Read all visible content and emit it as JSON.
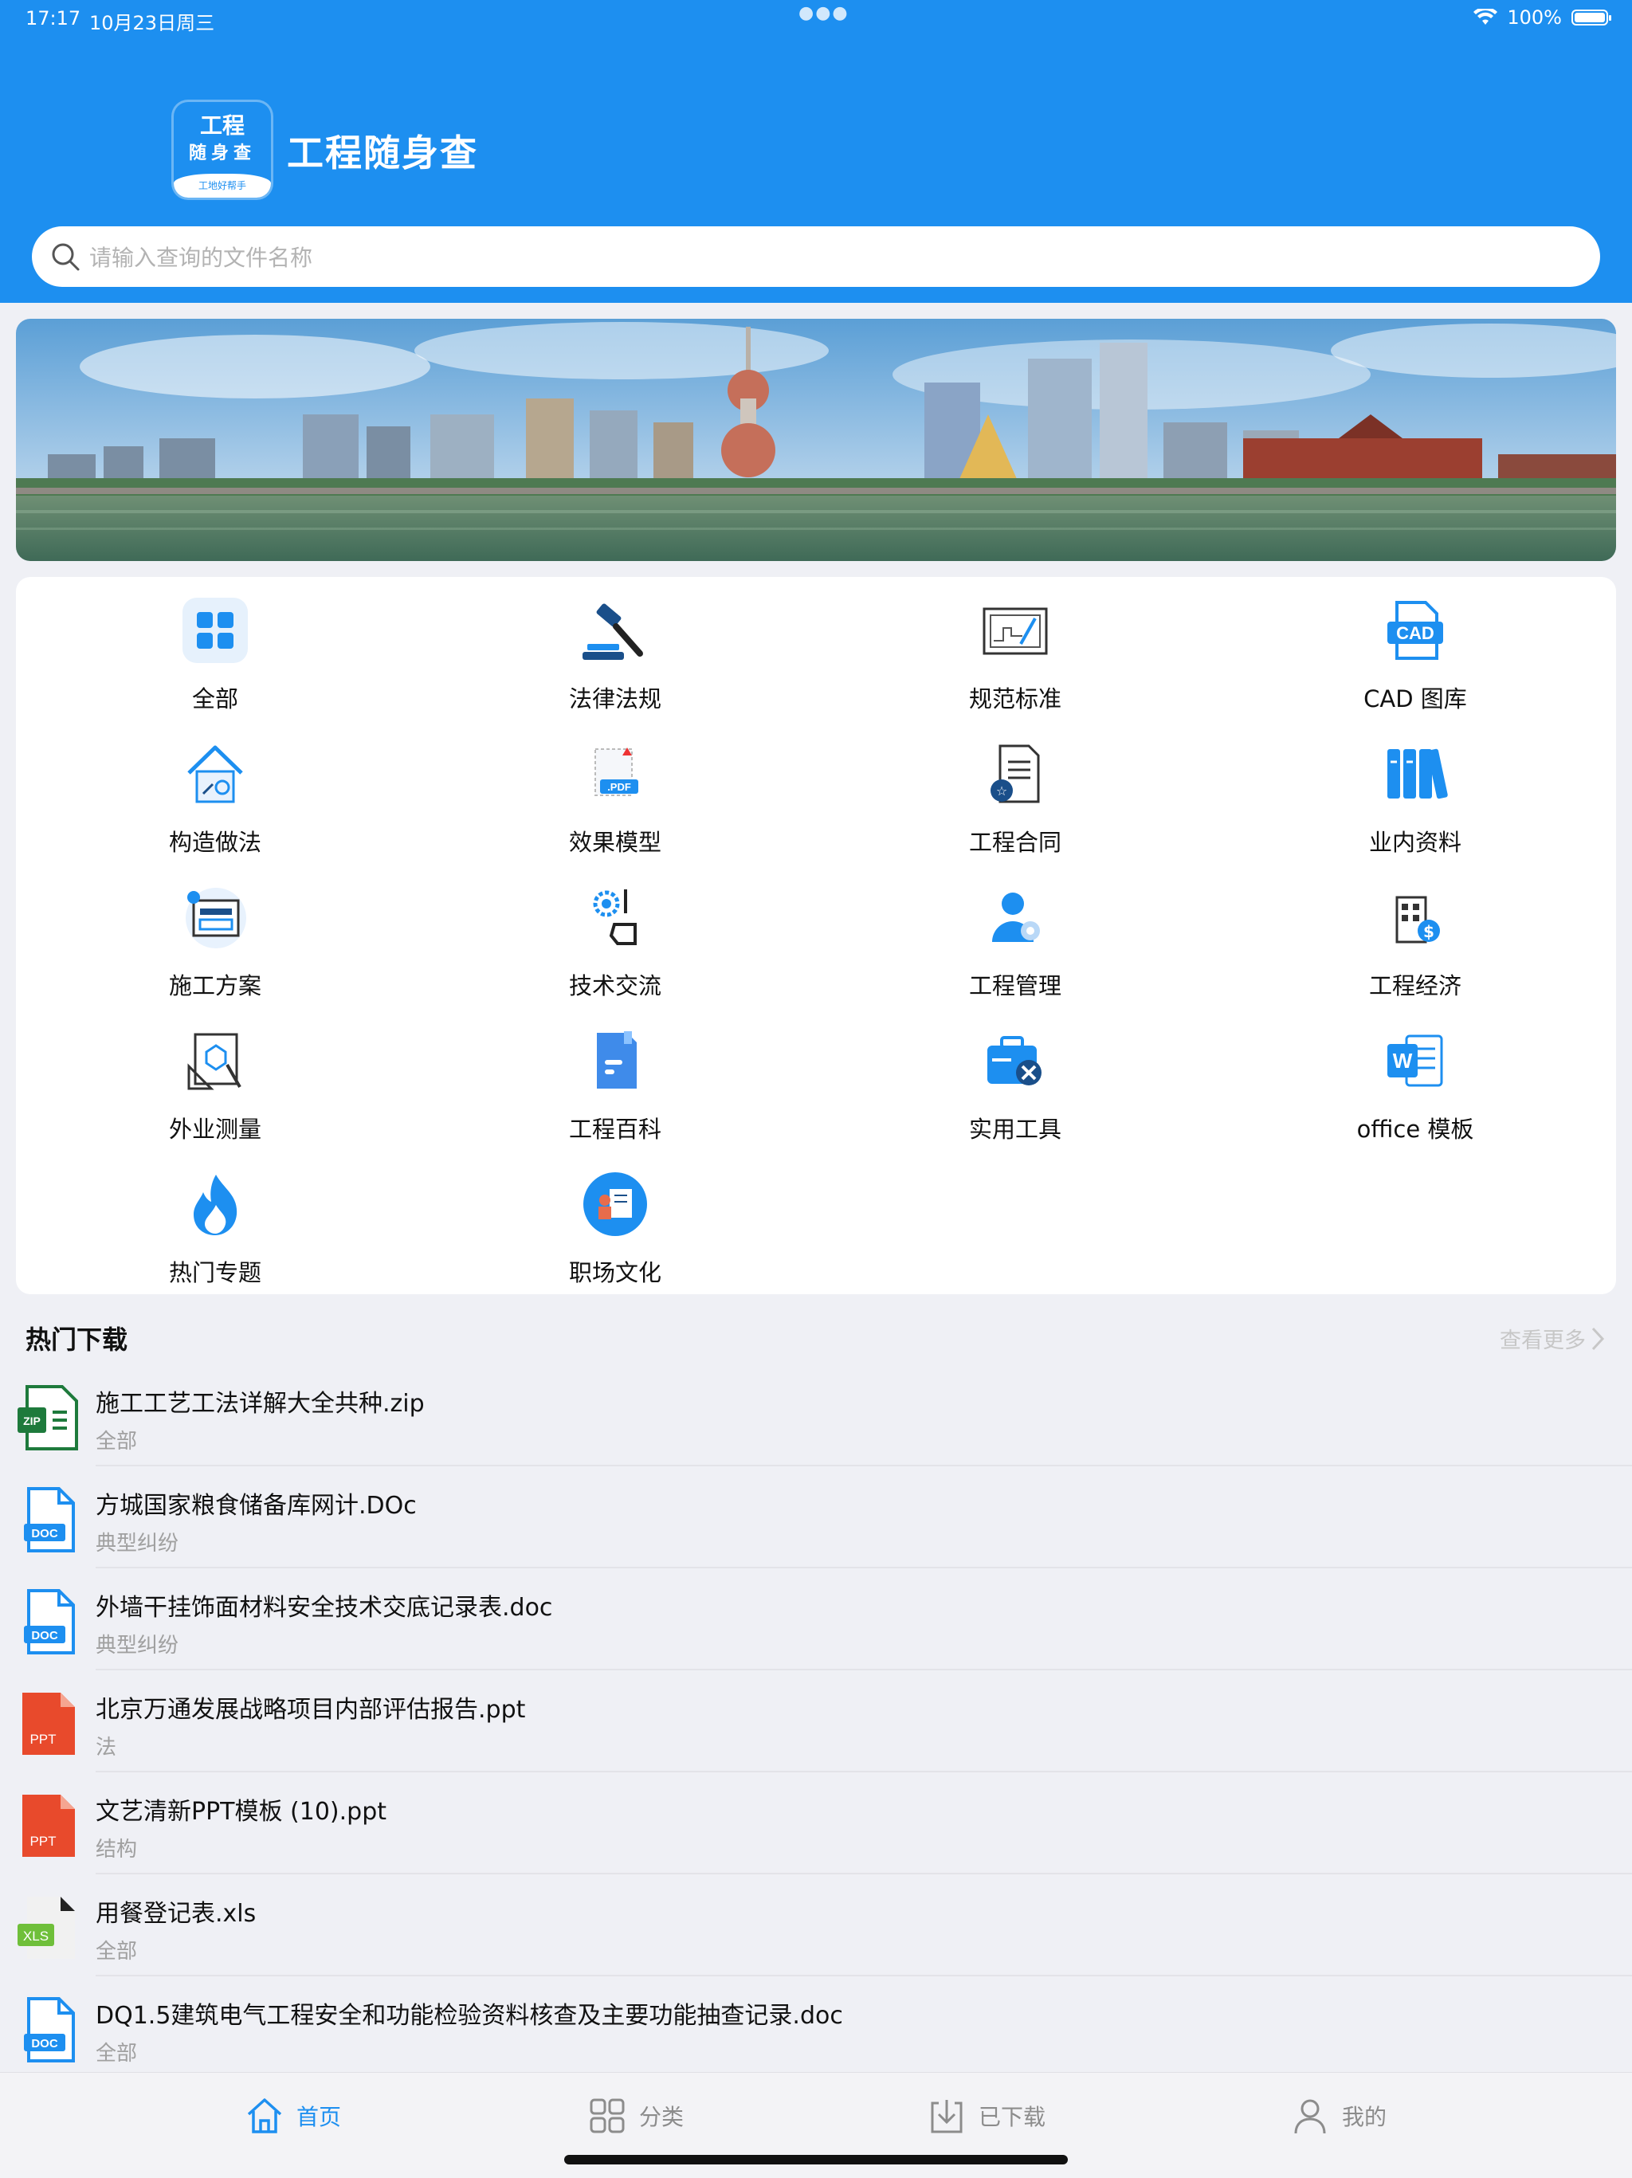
{
  "status_bar": {
    "time": "17:17",
    "date": "10月23日周三",
    "battery": "100%"
  },
  "app": {
    "logo_line1": "工程",
    "logo_line2": "随身查",
    "logo_line3": "工地好帮手",
    "title": "工程随身查"
  },
  "search": {
    "placeholder": "请输入查询的文件名称"
  },
  "categories": [
    {
      "label": "全部",
      "icon": "grid-icon"
    },
    {
      "label": "法律法规",
      "icon": "gavel-icon"
    },
    {
      "label": "规范标准",
      "icon": "blueprint-icon"
    },
    {
      "label": "CAD 图库",
      "icon": "cad-icon"
    },
    {
      "label": "构造做法",
      "icon": "house-icon"
    },
    {
      "label": "效果模型",
      "icon": "pdf-icon"
    },
    {
      "label": "工程合同",
      "icon": "contract-icon"
    },
    {
      "label": "业内资料",
      "icon": "books-icon"
    },
    {
      "label": "施工方案",
      "icon": "plan-icon"
    },
    {
      "label": "技术交流",
      "icon": "gear-hand-icon"
    },
    {
      "label": "工程管理",
      "icon": "manager-icon"
    },
    {
      "label": "工程经济",
      "icon": "building-dollar-icon"
    },
    {
      "label": "外业测量",
      "icon": "survey-icon"
    },
    {
      "label": "工程百科",
      "icon": "encyclopedia-icon"
    },
    {
      "label": "实用工具",
      "icon": "toolbox-icon"
    },
    {
      "label": "office 模板",
      "icon": "word-icon"
    },
    {
      "label": "热门专题",
      "icon": "fire-icon"
    },
    {
      "label": "职场文化",
      "icon": "workplace-icon"
    }
  ],
  "hot_downloads": {
    "title": "热门下载",
    "more": "查看更多",
    "files": [
      {
        "name": "施工工艺工法详解大全共种.zip",
        "category": "全部",
        "type": "ZIP"
      },
      {
        "name": "方城国家粮食储备库网计.DOc",
        "category": "典型纠纷",
        "type": "DOC"
      },
      {
        "name": "外墙干挂饰面材料安全技术交底记录表.doc",
        "category": "典型纠纷",
        "type": "DOC"
      },
      {
        "name": "北京万通发展战略项目内部评估报告.ppt",
        "category": "法",
        "type": "PPT"
      },
      {
        "name": "文艺清新PPT模板 (10).ppt",
        "category": "结构",
        "type": "PPT"
      },
      {
        "name": "用餐登记表.xls",
        "category": "全部",
        "type": "XLS"
      },
      {
        "name": "DQ1.5建筑电气工程安全和功能检验资料核查及主要功能抽查记录.doc",
        "category": "全部",
        "type": "DOC"
      }
    ]
  },
  "tabs": [
    {
      "label": "首页",
      "icon": "home-icon",
      "active": true
    },
    {
      "label": "分类",
      "icon": "category-icon",
      "active": false
    },
    {
      "label": "已下载",
      "icon": "download-icon",
      "active": false
    },
    {
      "label": "我的",
      "icon": "user-icon",
      "active": false
    }
  ],
  "colors": {
    "primary": "#1d8ff0",
    "background": "#eff0f5"
  }
}
